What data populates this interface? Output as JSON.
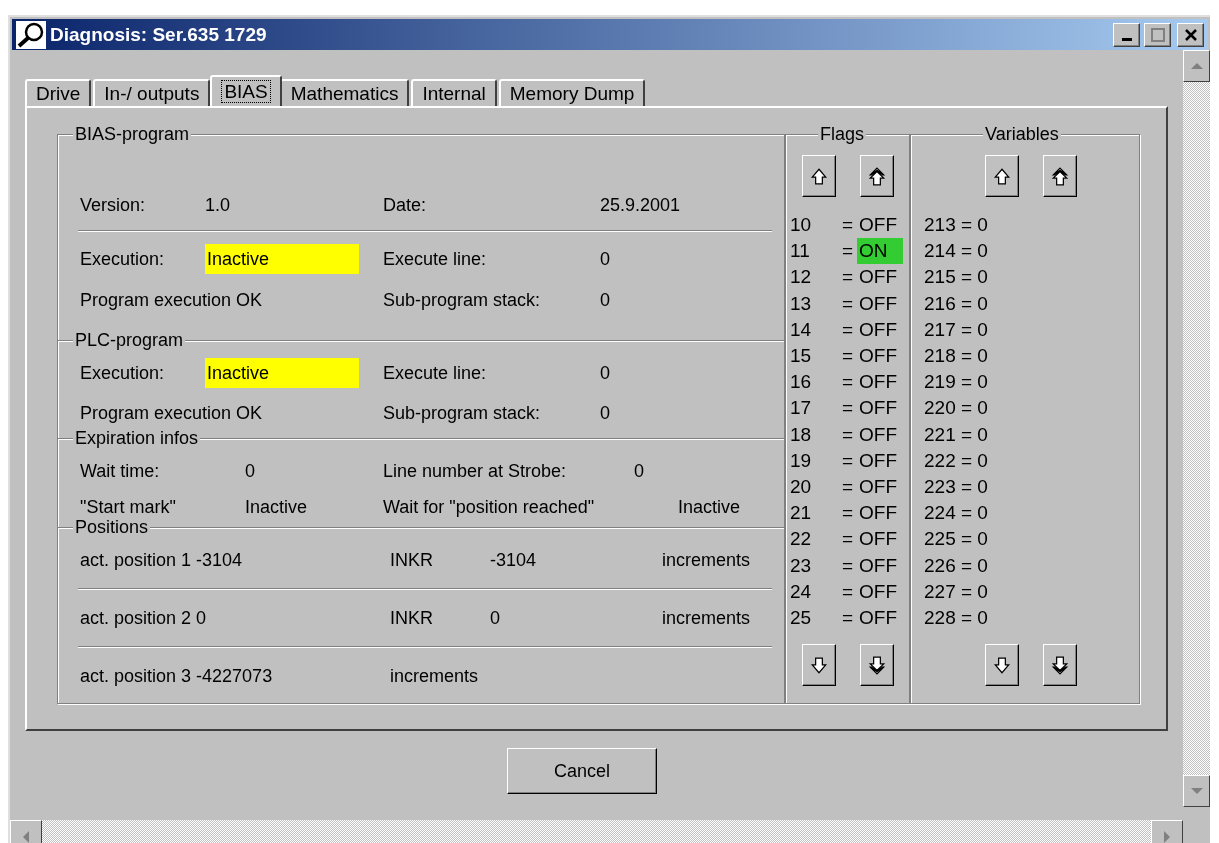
{
  "window": {
    "title": "Diagnosis: Ser.635 1729"
  },
  "tabs": [
    {
      "label": "Drive",
      "selected": false
    },
    {
      "label": "In-/ outputs",
      "selected": false
    },
    {
      "label": "BIAS",
      "selected": true
    },
    {
      "label": "Mathematics",
      "selected": false
    },
    {
      "label": "Internal",
      "selected": false
    },
    {
      "label": "Memory Dump",
      "selected": false
    }
  ],
  "bias_program": {
    "legend": "BIAS-program",
    "version_label": "Version:",
    "version": "1.0",
    "date_label": "Date:",
    "date": "25.9.2001",
    "execution_label": "Execution:",
    "execution": "Inactive",
    "execute_line_label": "Execute line:",
    "execute_line": "0",
    "status": "Program execution OK",
    "stack_label": "Sub-program stack:",
    "stack": "0"
  },
  "plc_program": {
    "legend": "PLC-program",
    "execution_label": "Execution:",
    "execution": "Inactive",
    "execute_line_label": "Execute line:",
    "execute_line": "0",
    "status": "Program execution OK",
    "stack_label": "Sub-program stack:",
    "stack": "0"
  },
  "expiration_infos": {
    "legend": "Expiration infos",
    "wait_time_label": "Wait time:",
    "wait_time": "0",
    "strobe_label": "Line number at Strobe:",
    "strobe": "0",
    "start_mark_label": "\"Start mark\"",
    "start_mark": "Inactive",
    "position_reached_label": "Wait for \"position reached\"",
    "position_reached": "Inactive"
  },
  "positions": {
    "legend": "Positions",
    "rows": [
      {
        "label": "act. position 1 -3104",
        "unit_label": "INKR",
        "value": "-3104",
        "unit": "increments"
      },
      {
        "label": "act. position 2 0",
        "unit_label": "INKR",
        "value": "0",
        "unit": "increments"
      },
      {
        "label": "act. position 3 -4227073",
        "unit": "increments"
      }
    ]
  },
  "flags": {
    "legend": "Flags",
    "items": [
      {
        "number": "10",
        "eq": "=",
        "value": "OFF",
        "on": false
      },
      {
        "number": "11",
        "eq": "=",
        "value": "ON",
        "on": true
      },
      {
        "number": "12",
        "eq": "=",
        "value": "OFF",
        "on": false
      },
      {
        "number": "13",
        "eq": "=",
        "value": "OFF",
        "on": false
      },
      {
        "number": "14",
        "eq": "=",
        "value": "OFF",
        "on": false
      },
      {
        "number": "15",
        "eq": "=",
        "value": "OFF",
        "on": false
      },
      {
        "number": "16",
        "eq": "=",
        "value": "OFF",
        "on": false
      },
      {
        "number": "17",
        "eq": "=",
        "value": "OFF",
        "on": false
      },
      {
        "number": "18",
        "eq": "=",
        "value": "OFF",
        "on": false
      },
      {
        "number": "19",
        "eq": "=",
        "value": "OFF",
        "on": false
      },
      {
        "number": "20",
        "eq": "=",
        "value": "OFF",
        "on": false
      },
      {
        "number": "21",
        "eq": "=",
        "value": "OFF",
        "on": false
      },
      {
        "number": "22",
        "eq": "=",
        "value": "OFF",
        "on": false
      },
      {
        "number": "23",
        "eq": "=",
        "value": "OFF",
        "on": false
      },
      {
        "number": "24",
        "eq": "=",
        "value": "OFF",
        "on": false
      },
      {
        "number": "25",
        "eq": "=",
        "value": "OFF",
        "on": false
      }
    ]
  },
  "variables": {
    "legend": "Variables",
    "items": [
      "213 = 0",
      "214 = 0",
      "215 = 0",
      "216 = 0",
      "217 = 0",
      "218 = 0",
      "219 = 0",
      "220 = 0",
      "221 = 0",
      "222 = 0",
      "223 = 0",
      "224 = 0",
      "225 = 0",
      "226 = 0",
      "227 = 0",
      "228 = 0"
    ]
  },
  "buttons": {
    "cancel": "Cancel"
  }
}
